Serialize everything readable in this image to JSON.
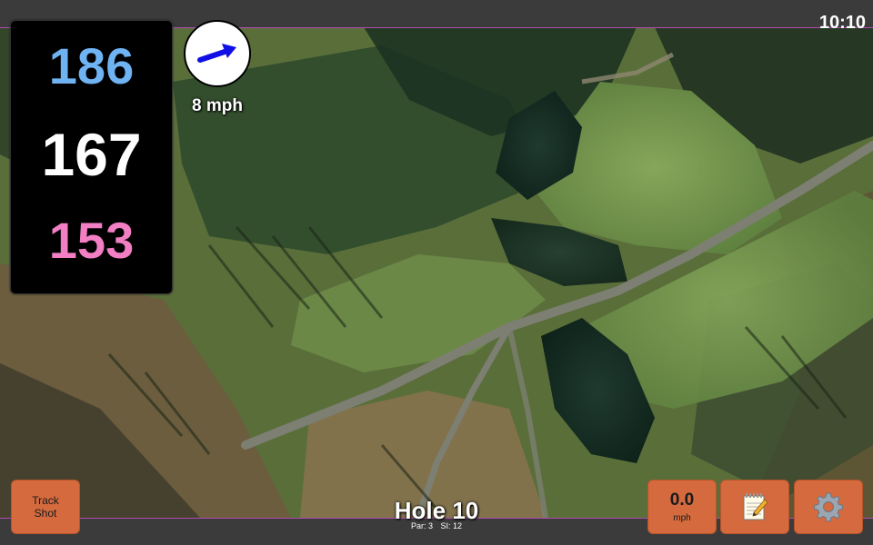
{
  "status_bar": {
    "time": "10:10"
  },
  "distances": {
    "back": "186",
    "middle": "167",
    "front": "153"
  },
  "wind": {
    "speed_label": "8 mph",
    "direction_icon": "wind-arrow-icon"
  },
  "buttons": {
    "track_shot_line1": "Track",
    "track_shot_line2": "Shot",
    "speed_value": "0.0",
    "speed_unit": "mph",
    "notes_icon": "notepad-icon",
    "settings_icon": "gear-icon"
  },
  "hole": {
    "title": "Hole 10",
    "par": "Par: 3",
    "si": "SI: 12"
  },
  "colors": {
    "back_distance": "#6fb3f2",
    "middle_distance": "#ffffff",
    "front_distance": "#f27fc4",
    "button": "#d46a3e",
    "bar_border": "#b04cb0"
  }
}
